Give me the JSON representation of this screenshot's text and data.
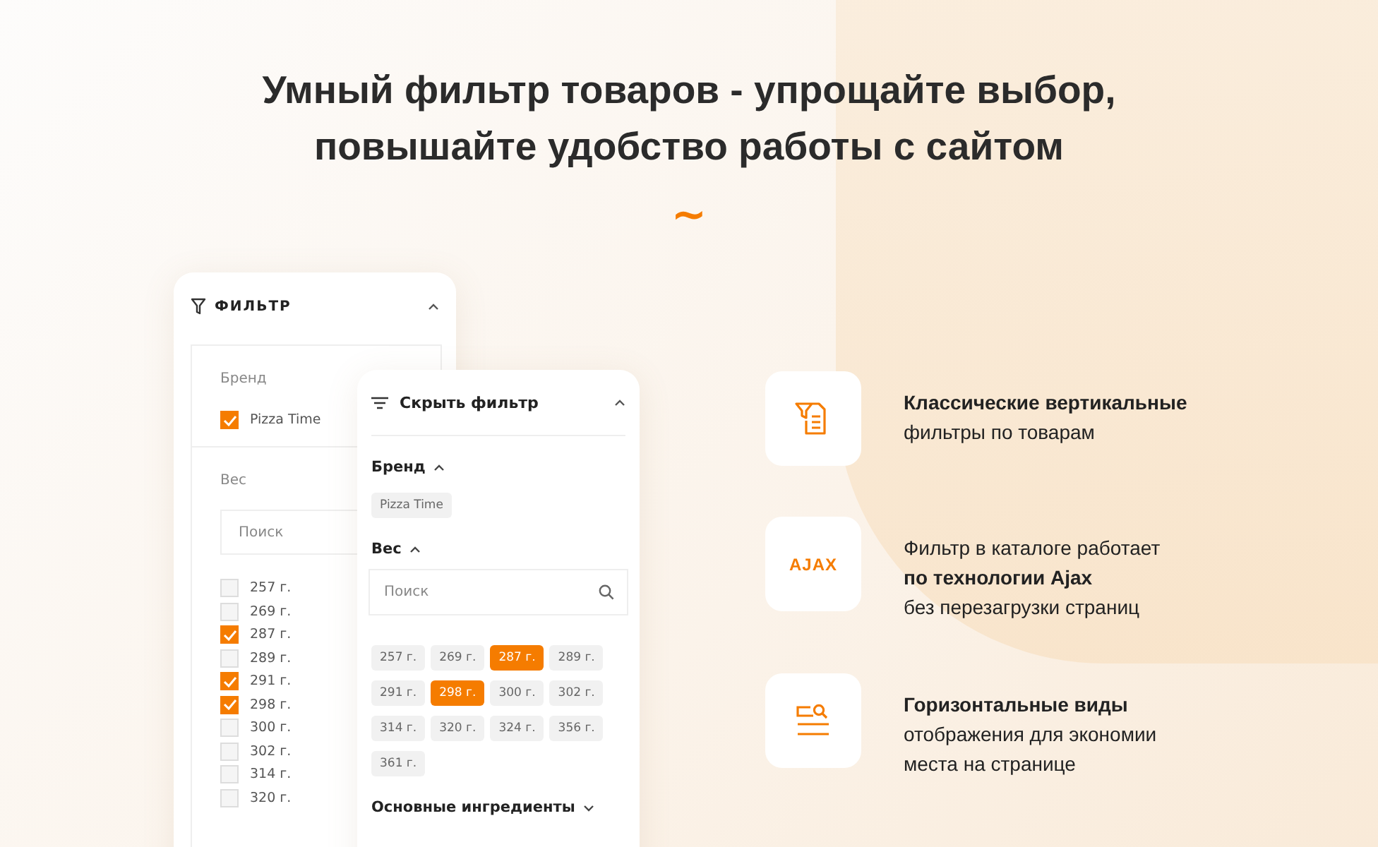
{
  "title": [
    "Умный фильтр товаров - упрощайте выбор,",
    "повышайте удобство работы с сайтом"
  ],
  "ornament": "~",
  "vertical_filter": {
    "title": "ФИЛЬТР",
    "brand_label": "Бренд",
    "brands": [
      {
        "label": "Pizza Time",
        "checked": true
      }
    ],
    "weight_label": "Вес",
    "search": {
      "placeholder": "Поиск"
    },
    "weights": [
      {
        "label": "257 г.",
        "checked": false
      },
      {
        "label": "269 г.",
        "checked": false
      },
      {
        "label": "287 г.",
        "checked": true
      },
      {
        "label": "289 г.",
        "checked": false
      },
      {
        "label": "291 г.",
        "checked": true
      },
      {
        "label": "298 г.",
        "checked": true
      },
      {
        "label": "300 г.",
        "checked": false
      },
      {
        "label": "302 г.",
        "checked": false
      },
      {
        "label": "314 г.",
        "checked": false
      },
      {
        "label": "320 г.",
        "checked": false
      }
    ]
  },
  "horizontal_filter": {
    "title": "Скрыть фильтр",
    "sections": [
      {
        "label": "Бренд",
        "expanded": true,
        "chips": [
          {
            "label": "Pizza Time",
            "selected": false
          }
        ]
      },
      {
        "label": "Вес",
        "expanded": true,
        "search": {
          "placeholder": "Поиск"
        },
        "chips": [
          {
            "label": "257 г.",
            "selected": false
          },
          {
            "label": "269 г.",
            "selected": false
          },
          {
            "label": "287 г.",
            "selected": true
          },
          {
            "label": "289 г.",
            "selected": false
          },
          {
            "label": "291 г.",
            "selected": false
          },
          {
            "label": "298 г.",
            "selected": true
          },
          {
            "label": "300 г.",
            "selected": false
          },
          {
            "label": "302 г.",
            "selected": false
          },
          {
            "label": "314 г.",
            "selected": false
          },
          {
            "label": "320 г.",
            "selected": false
          },
          {
            "label": "324 г.",
            "selected": false
          },
          {
            "label": "356 г.",
            "selected": false
          },
          {
            "label": "361 г.",
            "selected": false
          }
        ]
      },
      {
        "label": "Основные ингредиенты",
        "expanded": false
      }
    ]
  },
  "features": [
    {
      "kind": "filter-list",
      "lines": [
        "**Классические вертикальные**",
        "фильтры по товарам"
      ]
    },
    {
      "kind": "ajax",
      "logo_text": "AJAX",
      "lines": [
        "Фильтр в каталоге работает",
        "**по технологии Ajax**",
        "без перезагрузки страниц"
      ]
    },
    {
      "kind": "search-list",
      "lines": [
        "**Горизонтальные виды**",
        "отображения для экономии",
        "места на странице"
      ]
    }
  ]
}
